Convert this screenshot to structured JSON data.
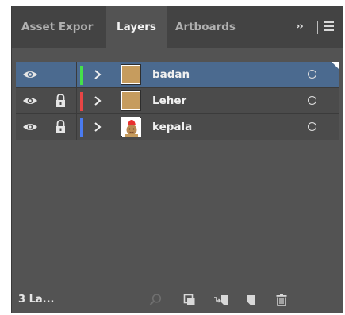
{
  "tabs": {
    "asset_export": "Asset Expor",
    "layers": "Layers",
    "artboards": "Artboards",
    "overflow": "››"
  },
  "layers": [
    {
      "name": "badan",
      "color": "#45e04a",
      "locked": false,
      "selected": true,
      "visible": true
    },
    {
      "name": "Leher",
      "color": "#e84545",
      "locked": true,
      "selected": false,
      "visible": true
    },
    {
      "name": "kepala",
      "color": "#4a7bf0",
      "locked": true,
      "selected": false,
      "visible": true
    }
  ],
  "footer": {
    "layer_count": "3 La..."
  },
  "colors": {
    "panel_bg": "#535353",
    "selected_row": "#4b6a8f",
    "tabbar_bg": "#434343"
  },
  "icons": [
    "eye-icon",
    "lock-icon",
    "chevron-right-icon",
    "target-circle-icon",
    "locate-object-icon",
    "make-clipping-mask-icon",
    "create-sublayer-icon",
    "new-layer-icon",
    "trash-icon",
    "panel-menu-icon"
  ]
}
